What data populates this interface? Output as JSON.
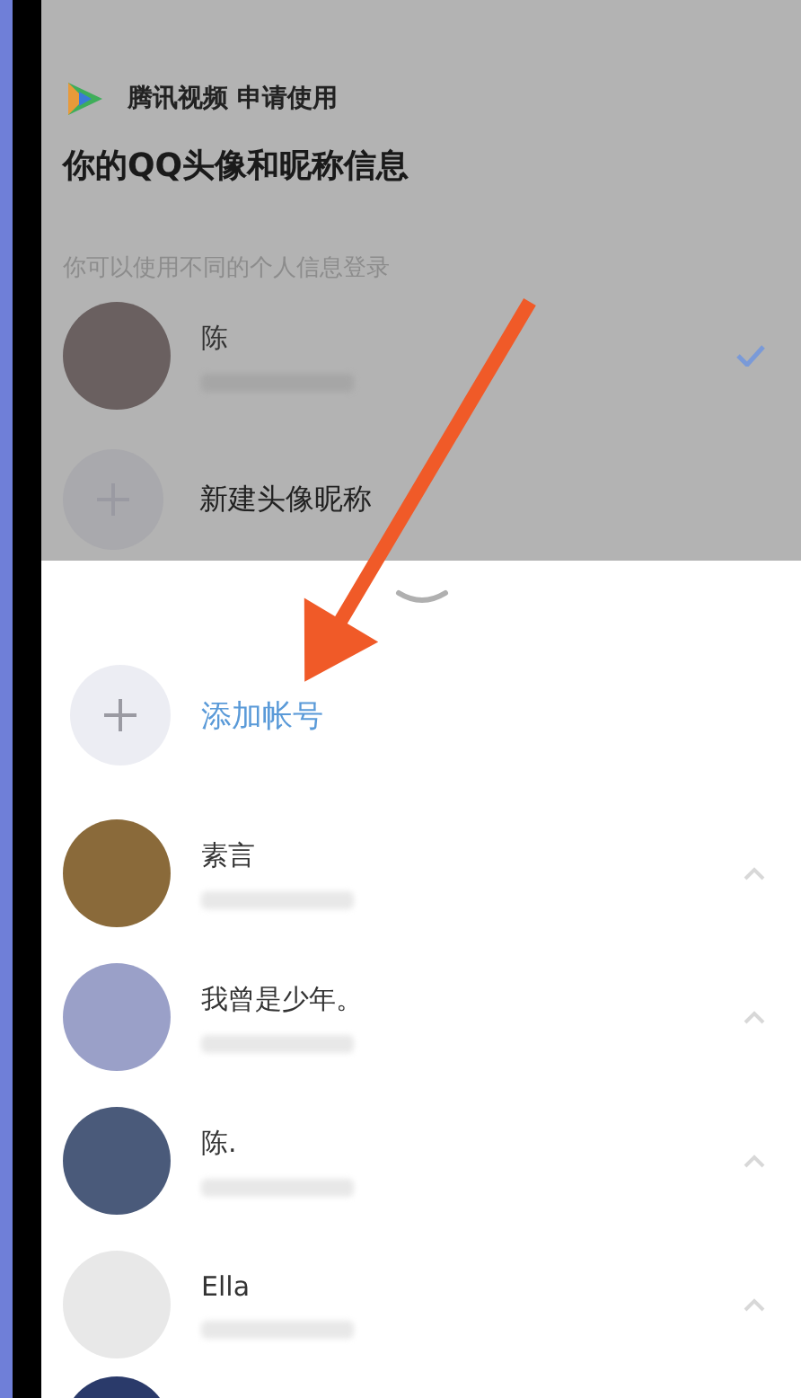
{
  "app": {
    "name": "腾讯视频 申请使用"
  },
  "title": "你的QQ头像和昵称信息",
  "hint": "你可以使用不同的个人信息登录",
  "profiles": [
    {
      "name": "陈",
      "selected": true
    }
  ],
  "new_profile": {
    "label": "新建头像昵称"
  },
  "add_account": {
    "label": "添加帐号"
  },
  "accounts": [
    {
      "name": "素言"
    },
    {
      "name": "我曾是少年。"
    },
    {
      "name": "陈."
    },
    {
      "name": "Ella"
    }
  ]
}
